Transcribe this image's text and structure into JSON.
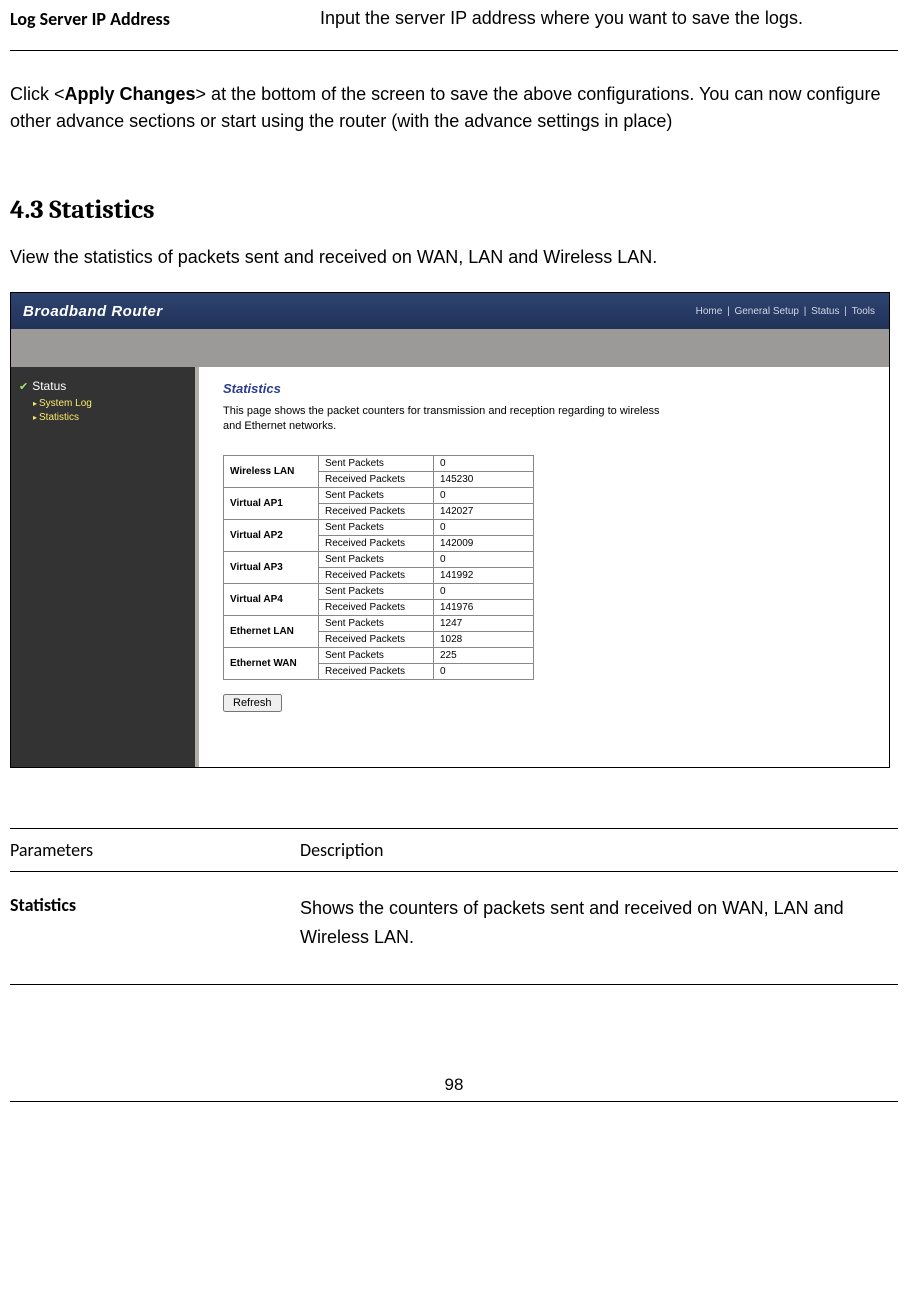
{
  "top_param": {
    "name": "Log Server IP Address",
    "desc": "Input the server IP address where you want to save the logs."
  },
  "apply_text": {
    "prefix": "Click <",
    "btn": "Apply Changes",
    "suffix": "> at the bottom of the screen to save the above configurations. You can now configure other advance sections or start using the router (with the advance settings in place)"
  },
  "section_title": "4.3 Statistics",
  "section_intro": "View the statistics of packets sent and received on WAN, LAN and Wireless LAN.",
  "shot": {
    "brand": "Broadband Router",
    "topnav": [
      "Home",
      "General Setup",
      "Status",
      "Tools"
    ],
    "sidebar": {
      "root": "Status",
      "items": [
        "System Log",
        "Statistics"
      ]
    },
    "content_title": "Statistics",
    "content_desc": "This page shows the packet counters for transmission and reception regarding to wireless and Ethernet networks.",
    "rows": [
      {
        "iface": "Wireless LAN",
        "sent": "0",
        "recv": "145230"
      },
      {
        "iface": "Virtual AP1",
        "sent": "0",
        "recv": "142027"
      },
      {
        "iface": "Virtual AP2",
        "sent": "0",
        "recv": "142009"
      },
      {
        "iface": "Virtual AP3",
        "sent": "0",
        "recv": "141992"
      },
      {
        "iface": "Virtual AP4",
        "sent": "0",
        "recv": "141976"
      },
      {
        "iface": "Ethernet LAN",
        "sent": "1247",
        "recv": "1028"
      },
      {
        "iface": "Ethernet WAN",
        "sent": "225",
        "recv": "0"
      }
    ],
    "labels": {
      "sent": "Sent Packets",
      "recv": "Received Packets"
    },
    "refresh": "Refresh"
  },
  "params": {
    "head": {
      "c1": "Parameters",
      "c2": "Description"
    },
    "row": {
      "c1": "Statistics",
      "c2": "Shows the counters of packets sent and received on WAN, LAN and Wireless LAN."
    }
  },
  "pagenum": "98"
}
